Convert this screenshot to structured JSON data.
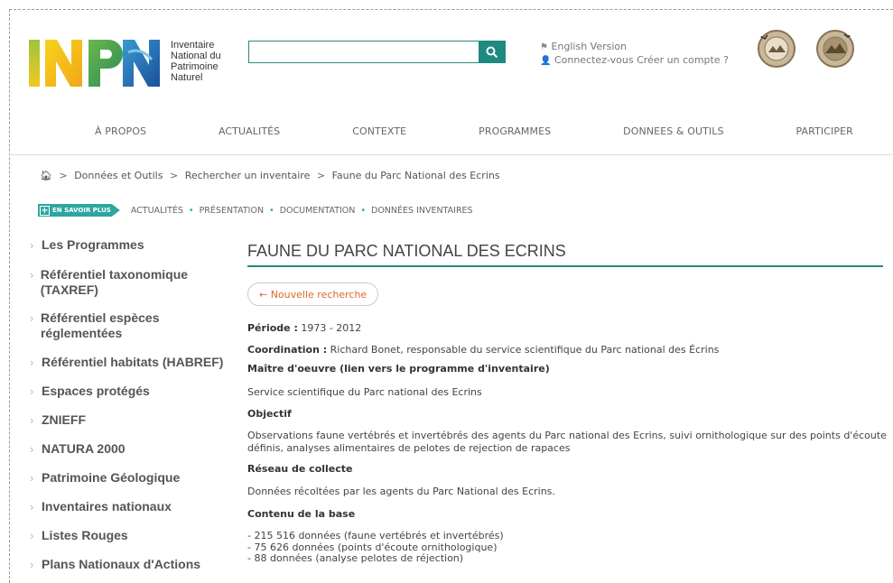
{
  "header": {
    "logo": {
      "letters": "INPN",
      "text_lines": [
        "Inventaire",
        "National du",
        "Patrimoine",
        "Naturel"
      ]
    },
    "search": {
      "value": "",
      "placeholder": ""
    },
    "english_version": "English Version",
    "connect": "Connectez-vous",
    "create_account": "Créer un compte ?"
  },
  "nav": [
    "À PROPOS",
    "ACTUALITÉS",
    "CONTEXTE",
    "PROGRAMMES",
    "DONNEES & OUTILS",
    "PARTICIPER"
  ],
  "breadcrumb": [
    "Données et Outils",
    "Rechercher un inventaire",
    "Faune du Parc National des Ecrins"
  ],
  "subnav": {
    "badge": "EN SAVOIR PLUS",
    "items": [
      "ACTUALITÉS",
      "PRÉSENTATION",
      "DOCUMENTATION",
      "DONNÉES INVENTAIRES"
    ]
  },
  "sidebar": [
    "Les Programmes",
    "Référentiel taxonomique (TAXREF)",
    "Référentiel espèces réglementées",
    "Référentiel habitats (HABREF)",
    "Espaces protégés",
    "ZNIEFF",
    "NATURA 2000",
    "Patrimoine Géologique",
    "Inventaires nationaux",
    "Listes Rouges",
    "Plans Nationaux d'Actions"
  ],
  "main": {
    "title": "FAUNE DU PARC NATIONAL DES ECRINS",
    "back_button": "← Nouvelle recherche",
    "periode_label": "Période :",
    "periode_value": "1973 - 2012",
    "coordination_label": "Coordination :",
    "coordination_value": "Richard Bonet, responsable du service scientifique du Parc national des Écrins",
    "maitre_heading": "Maître d'oeuvre (lien vers le programme d'inventaire)",
    "maitre_value": "Service scientifique du Parc national des Ecrins",
    "objectif_heading": "Objectif",
    "objectif_value": "Observations faune vertébrés et invertébrés des agents du Parc national des Ecrins, suivi ornithologique sur des points d'écoute définis, analyses alimentaires de pelotes de rejection de rapaces",
    "reseau_heading": "Réseau de collecte",
    "reseau_value": "Données récoltées par les agents du Parc National des Ecrins.",
    "contenu_heading": "Contenu de la base",
    "contenu_items": [
      "- 215 516 données (faune vertébrés et invertébrés)",
      "- 75 626 données (points d'écoute ornithologique)",
      "- 88 données (analyse pelotes de réjection)"
    ]
  },
  "colors": {
    "accent": "#1e8a80",
    "badge": "#2ea6a0",
    "link_orange": "#d96a2a"
  }
}
